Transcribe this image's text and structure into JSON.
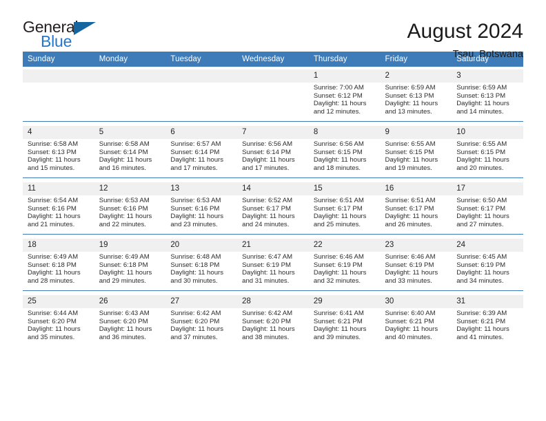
{
  "brand": {
    "name_part1": "General",
    "name_part2": "Blue",
    "triangle_color": "#15659f",
    "blue_color": "#2277cc"
  },
  "header": {
    "month_title": "August 2024",
    "location": "Tsau, Botswana"
  },
  "theme": {
    "header_blue": "#3d7cb8",
    "daynum_bg": "#f0f0f0"
  },
  "weekdays": [
    "Sunday",
    "Monday",
    "Tuesday",
    "Wednesday",
    "Thursday",
    "Friday",
    "Saturday"
  ],
  "weeks": [
    {
      "days": [
        {
          "num": "",
          "sunrise": "",
          "sunset": "",
          "daylight1": "",
          "daylight2": ""
        },
        {
          "num": "",
          "sunrise": "",
          "sunset": "",
          "daylight1": "",
          "daylight2": ""
        },
        {
          "num": "",
          "sunrise": "",
          "sunset": "",
          "daylight1": "",
          "daylight2": ""
        },
        {
          "num": "",
          "sunrise": "",
          "sunset": "",
          "daylight1": "",
          "daylight2": ""
        },
        {
          "num": "1",
          "sunrise": "Sunrise: 7:00 AM",
          "sunset": "Sunset: 6:12 PM",
          "daylight1": "Daylight: 11 hours",
          "daylight2": "and 12 minutes."
        },
        {
          "num": "2",
          "sunrise": "Sunrise: 6:59 AM",
          "sunset": "Sunset: 6:13 PM",
          "daylight1": "Daylight: 11 hours",
          "daylight2": "and 13 minutes."
        },
        {
          "num": "3",
          "sunrise": "Sunrise: 6:59 AM",
          "sunset": "Sunset: 6:13 PM",
          "daylight1": "Daylight: 11 hours",
          "daylight2": "and 14 minutes."
        }
      ]
    },
    {
      "days": [
        {
          "num": "4",
          "sunrise": "Sunrise: 6:58 AM",
          "sunset": "Sunset: 6:13 PM",
          "daylight1": "Daylight: 11 hours",
          "daylight2": "and 15 minutes."
        },
        {
          "num": "5",
          "sunrise": "Sunrise: 6:58 AM",
          "sunset": "Sunset: 6:14 PM",
          "daylight1": "Daylight: 11 hours",
          "daylight2": "and 16 minutes."
        },
        {
          "num": "6",
          "sunrise": "Sunrise: 6:57 AM",
          "sunset": "Sunset: 6:14 PM",
          "daylight1": "Daylight: 11 hours",
          "daylight2": "and 17 minutes."
        },
        {
          "num": "7",
          "sunrise": "Sunrise: 6:56 AM",
          "sunset": "Sunset: 6:14 PM",
          "daylight1": "Daylight: 11 hours",
          "daylight2": "and 17 minutes."
        },
        {
          "num": "8",
          "sunrise": "Sunrise: 6:56 AM",
          "sunset": "Sunset: 6:15 PM",
          "daylight1": "Daylight: 11 hours",
          "daylight2": "and 18 minutes."
        },
        {
          "num": "9",
          "sunrise": "Sunrise: 6:55 AM",
          "sunset": "Sunset: 6:15 PM",
          "daylight1": "Daylight: 11 hours",
          "daylight2": "and 19 minutes."
        },
        {
          "num": "10",
          "sunrise": "Sunrise: 6:55 AM",
          "sunset": "Sunset: 6:15 PM",
          "daylight1": "Daylight: 11 hours",
          "daylight2": "and 20 minutes."
        }
      ]
    },
    {
      "days": [
        {
          "num": "11",
          "sunrise": "Sunrise: 6:54 AM",
          "sunset": "Sunset: 6:16 PM",
          "daylight1": "Daylight: 11 hours",
          "daylight2": "and 21 minutes."
        },
        {
          "num": "12",
          "sunrise": "Sunrise: 6:53 AM",
          "sunset": "Sunset: 6:16 PM",
          "daylight1": "Daylight: 11 hours",
          "daylight2": "and 22 minutes."
        },
        {
          "num": "13",
          "sunrise": "Sunrise: 6:53 AM",
          "sunset": "Sunset: 6:16 PM",
          "daylight1": "Daylight: 11 hours",
          "daylight2": "and 23 minutes."
        },
        {
          "num": "14",
          "sunrise": "Sunrise: 6:52 AM",
          "sunset": "Sunset: 6:17 PM",
          "daylight1": "Daylight: 11 hours",
          "daylight2": "and 24 minutes."
        },
        {
          "num": "15",
          "sunrise": "Sunrise: 6:51 AM",
          "sunset": "Sunset: 6:17 PM",
          "daylight1": "Daylight: 11 hours",
          "daylight2": "and 25 minutes."
        },
        {
          "num": "16",
          "sunrise": "Sunrise: 6:51 AM",
          "sunset": "Sunset: 6:17 PM",
          "daylight1": "Daylight: 11 hours",
          "daylight2": "and 26 minutes."
        },
        {
          "num": "17",
          "sunrise": "Sunrise: 6:50 AM",
          "sunset": "Sunset: 6:17 PM",
          "daylight1": "Daylight: 11 hours",
          "daylight2": "and 27 minutes."
        }
      ]
    },
    {
      "days": [
        {
          "num": "18",
          "sunrise": "Sunrise: 6:49 AM",
          "sunset": "Sunset: 6:18 PM",
          "daylight1": "Daylight: 11 hours",
          "daylight2": "and 28 minutes."
        },
        {
          "num": "19",
          "sunrise": "Sunrise: 6:49 AM",
          "sunset": "Sunset: 6:18 PM",
          "daylight1": "Daylight: 11 hours",
          "daylight2": "and 29 minutes."
        },
        {
          "num": "20",
          "sunrise": "Sunrise: 6:48 AM",
          "sunset": "Sunset: 6:18 PM",
          "daylight1": "Daylight: 11 hours",
          "daylight2": "and 30 minutes."
        },
        {
          "num": "21",
          "sunrise": "Sunrise: 6:47 AM",
          "sunset": "Sunset: 6:19 PM",
          "daylight1": "Daylight: 11 hours",
          "daylight2": "and 31 minutes."
        },
        {
          "num": "22",
          "sunrise": "Sunrise: 6:46 AM",
          "sunset": "Sunset: 6:19 PM",
          "daylight1": "Daylight: 11 hours",
          "daylight2": "and 32 minutes."
        },
        {
          "num": "23",
          "sunrise": "Sunrise: 6:46 AM",
          "sunset": "Sunset: 6:19 PM",
          "daylight1": "Daylight: 11 hours",
          "daylight2": "and 33 minutes."
        },
        {
          "num": "24",
          "sunrise": "Sunrise: 6:45 AM",
          "sunset": "Sunset: 6:19 PM",
          "daylight1": "Daylight: 11 hours",
          "daylight2": "and 34 minutes."
        }
      ]
    },
    {
      "days": [
        {
          "num": "25",
          "sunrise": "Sunrise: 6:44 AM",
          "sunset": "Sunset: 6:20 PM",
          "daylight1": "Daylight: 11 hours",
          "daylight2": "and 35 minutes."
        },
        {
          "num": "26",
          "sunrise": "Sunrise: 6:43 AM",
          "sunset": "Sunset: 6:20 PM",
          "daylight1": "Daylight: 11 hours",
          "daylight2": "and 36 minutes."
        },
        {
          "num": "27",
          "sunrise": "Sunrise: 6:42 AM",
          "sunset": "Sunset: 6:20 PM",
          "daylight1": "Daylight: 11 hours",
          "daylight2": "and 37 minutes."
        },
        {
          "num": "28",
          "sunrise": "Sunrise: 6:42 AM",
          "sunset": "Sunset: 6:20 PM",
          "daylight1": "Daylight: 11 hours",
          "daylight2": "and 38 minutes."
        },
        {
          "num": "29",
          "sunrise": "Sunrise: 6:41 AM",
          "sunset": "Sunset: 6:21 PM",
          "daylight1": "Daylight: 11 hours",
          "daylight2": "and 39 minutes."
        },
        {
          "num": "30",
          "sunrise": "Sunrise: 6:40 AM",
          "sunset": "Sunset: 6:21 PM",
          "daylight1": "Daylight: 11 hours",
          "daylight2": "and 40 minutes."
        },
        {
          "num": "31",
          "sunrise": "Sunrise: 6:39 AM",
          "sunset": "Sunset: 6:21 PM",
          "daylight1": "Daylight: 11 hours",
          "daylight2": "and 41 minutes."
        }
      ]
    }
  ]
}
